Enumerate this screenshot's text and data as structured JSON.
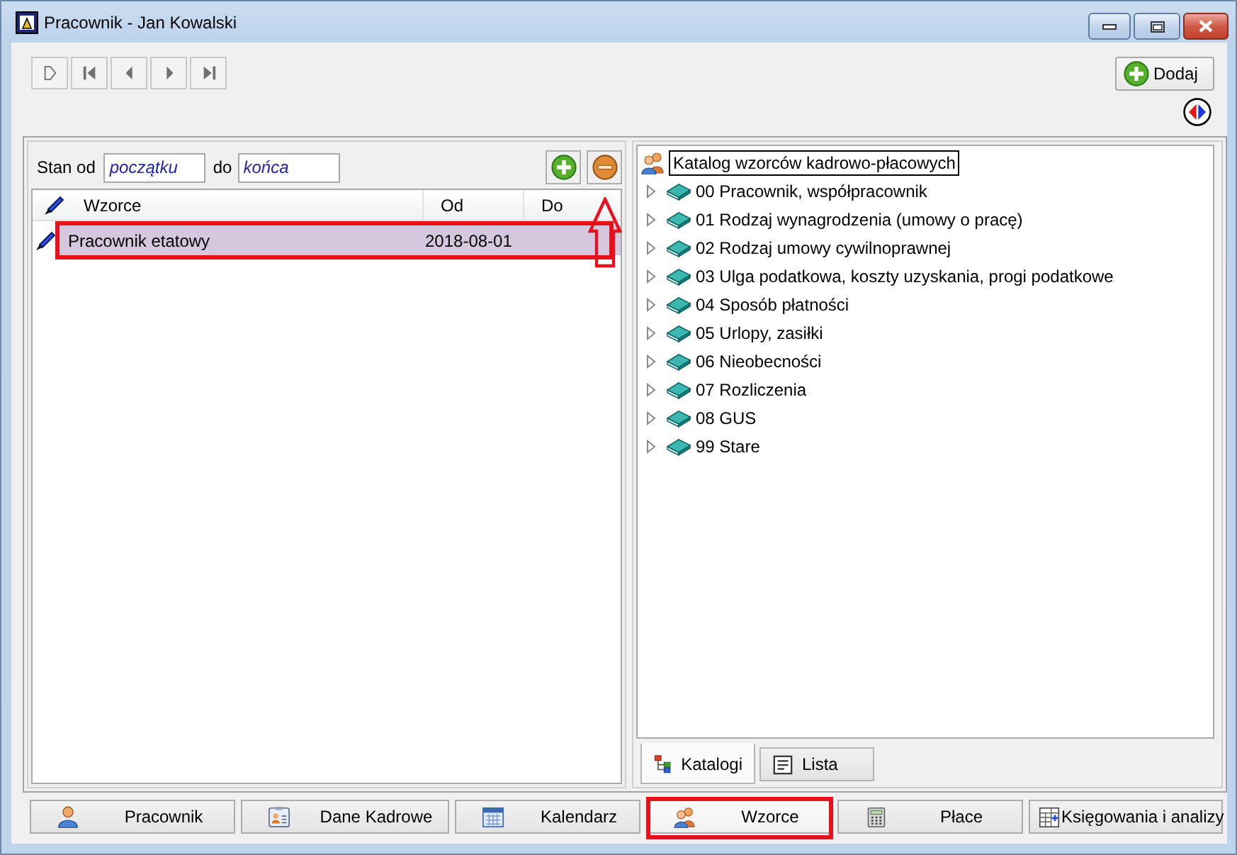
{
  "window": {
    "title": "Pracownik - Jan Kowalski"
  },
  "toolbar": {
    "add_button": {
      "label": "Dodaj"
    }
  },
  "left_panel": {
    "range": {
      "from_label": "Stan od",
      "from_value": "początku",
      "to_label": "do",
      "to_value": "końca"
    },
    "remove_button": {
      "pointed_by_arrow": true
    },
    "columns": [
      "Wzorce",
      "Od",
      "Do"
    ],
    "rows": [
      {
        "template": "Pracownik etatowy",
        "from": "2018-08-01",
        "selected": true,
        "highlighted": true
      }
    ]
  },
  "right_panel": {
    "tree": {
      "label": "Katalog wzorców kadrowo-płacowych",
      "focused": true,
      "children": [
        {
          "label": "00 Pracownik, współpracownik",
          "expanded": false
        },
        {
          "label": "01 Rodzaj wynagrodzenia (umowy o pracę)",
          "expanded": false
        },
        {
          "label": "02 Rodzaj umowy cywilnoprawnej",
          "expanded": false
        },
        {
          "label": "03 Ulga podatkowa, koszty uzyskania, progi podatkowe",
          "expanded": false
        },
        {
          "label": "04 Sposób płatności",
          "expanded": false
        },
        {
          "label": "05 Urlopy, zasiłki",
          "expanded": false
        },
        {
          "label": "06 Nieobecności",
          "expanded": false
        },
        {
          "label": "07 Rozliczenia",
          "expanded": false
        },
        {
          "label": "08 GUS",
          "expanded": false
        },
        {
          "label": "99 Stare",
          "expanded": false
        }
      ]
    },
    "tabs": [
      {
        "label": "Katalogi",
        "kind": "tree",
        "selected": true
      },
      {
        "label": "Lista",
        "kind": "list",
        "selected": false
      }
    ]
  },
  "module_tabs": [
    {
      "label": "Pracownik",
      "kind": "person",
      "selected": false,
      "highlighted": false
    },
    {
      "label": "Dane Kadrowe",
      "kind": "card",
      "selected": false,
      "highlighted": false
    },
    {
      "label": "Kalendarz",
      "kind": "calendar",
      "selected": false,
      "highlighted": false
    },
    {
      "label": "Wzorce",
      "kind": "people",
      "selected": true,
      "highlighted": true
    },
    {
      "label": "Płace",
      "kind": "calculator",
      "selected": false,
      "highlighted": false
    },
    {
      "label": "Księgowania i analizy",
      "kind": "sheet",
      "selected": false,
      "highlighted": false
    }
  ]
}
